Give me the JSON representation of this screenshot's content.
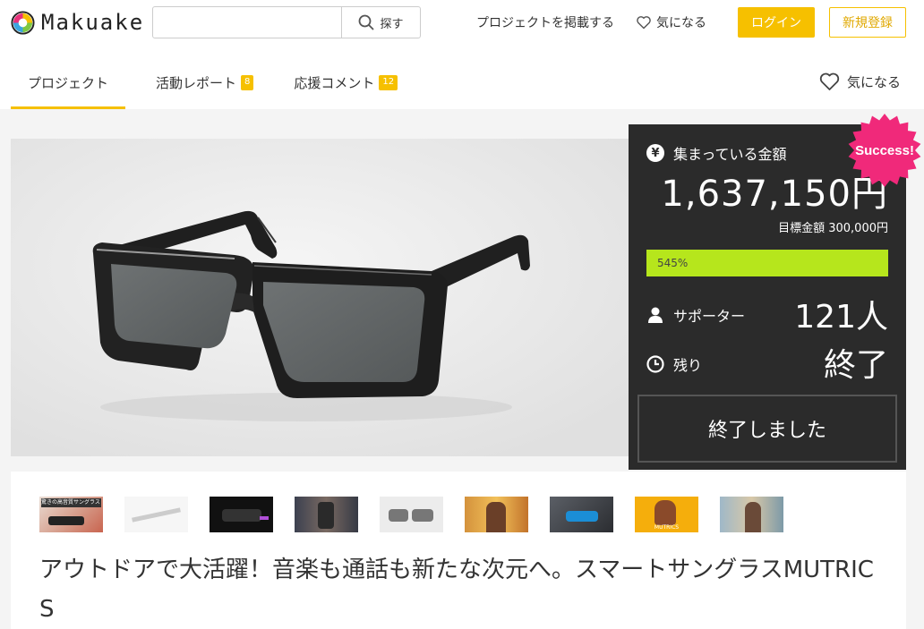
{
  "header": {
    "logo_text": "Makuake",
    "search": {
      "placeholder": "",
      "value": "",
      "button_label": "探す"
    },
    "nav": {
      "post_project": "プロジェクトを掲載する",
      "favorites": "気になる"
    },
    "login_label": "ログイン",
    "register_label": "新規登録",
    "brand_color": "#f6c000"
  },
  "tabs": [
    {
      "label": "プロジェクト",
      "badge": "",
      "active": true
    },
    {
      "label": "活動レポート",
      "badge": "8",
      "active": false
    },
    {
      "label": "応援コメント",
      "badge": "12",
      "active": false
    }
  ],
  "favorite_right": "気になる",
  "panel": {
    "collected_label": "集まっている金額",
    "collected_icon": "yen-icon",
    "amount": "1,637,150円",
    "goal": "目標金額 300,000円",
    "progress_label": "545%",
    "progress_fraction": 1.0,
    "supporters_label": "サポーター",
    "supporters_value": "121人",
    "remaining_label": "残り",
    "remaining_value": "終了",
    "ended_button": "終了しました",
    "success_badge": "Success!",
    "progress_color": "#b6e61c",
    "badge_color": "#f0297a"
  },
  "thumbnails": [
    {
      "name": "thumb-1",
      "caption": "驚きの高音質サングラス"
    },
    {
      "name": "thumb-2",
      "caption": ""
    },
    {
      "name": "thumb-3",
      "caption": ""
    },
    {
      "name": "thumb-4",
      "caption": ""
    },
    {
      "name": "thumb-5",
      "caption": ""
    },
    {
      "name": "thumb-6",
      "caption": ""
    },
    {
      "name": "thumb-7",
      "caption": ""
    },
    {
      "name": "thumb-8",
      "caption": "MUTRICS"
    },
    {
      "name": "thumb-9",
      "caption": ""
    }
  ],
  "project_title": "アウトドアで大活躍！音楽も通話も新たな次元へ。スマートサングラスMUTRICS"
}
